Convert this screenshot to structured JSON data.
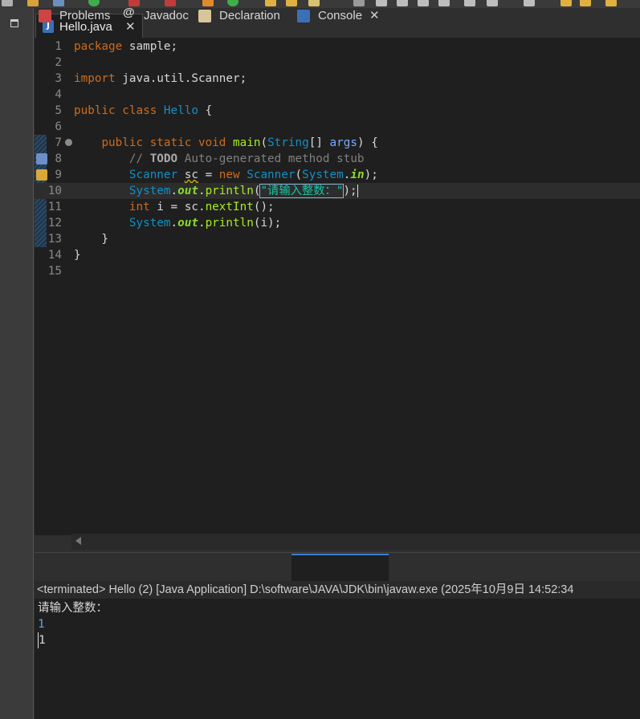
{
  "editor": {
    "tab": {
      "label": "Hello.java",
      "icon": "java-file-icon"
    },
    "lines": [
      {
        "n": "1",
        "tokens": [
          {
            "c": "kw",
            "t": "package"
          },
          {
            "c": "",
            "t": " sample;"
          }
        ]
      },
      {
        "n": "2",
        "tokens": []
      },
      {
        "n": "3",
        "tokens": [
          {
            "c": "kw",
            "t": "import"
          },
          {
            "c": "",
            "t": " java.util.Scanner;"
          }
        ]
      },
      {
        "n": "4",
        "tokens": []
      },
      {
        "n": "5",
        "tokens": [
          {
            "c": "kw",
            "t": "public"
          },
          {
            "c": "",
            "t": " "
          },
          {
            "c": "kw",
            "t": "class"
          },
          {
            "c": "",
            "t": " "
          },
          {
            "c": "cls",
            "t": "Hello"
          },
          {
            "c": "",
            "t": " {"
          }
        ]
      },
      {
        "n": "6",
        "tokens": []
      },
      {
        "n": "7",
        "tokens": [
          {
            "c": "",
            "t": "    "
          },
          {
            "c": "kw",
            "t": "public"
          },
          {
            "c": "",
            "t": " "
          },
          {
            "c": "kw",
            "t": "static"
          },
          {
            "c": "",
            "t": " "
          },
          {
            "c": "kw",
            "t": "void"
          },
          {
            "c": "",
            "t": " "
          },
          {
            "c": "meth",
            "t": "main"
          },
          {
            "c": "",
            "t": "("
          },
          {
            "c": "ty",
            "t": "String"
          },
          {
            "c": "",
            "t": "[] "
          },
          {
            "c": "param",
            "t": "args"
          },
          {
            "c": "",
            "t": ") {"
          }
        ]
      },
      {
        "n": "8",
        "tokens": [
          {
            "c": "",
            "t": "        "
          },
          {
            "c": "cmt",
            "t": "// "
          },
          {
            "c": "todo",
            "t": "TODO"
          },
          {
            "c": "cmt",
            "t": " Auto-generated method stub"
          }
        ]
      },
      {
        "n": "9",
        "tokens": [
          {
            "c": "",
            "t": "        "
          },
          {
            "c": "ty",
            "t": "Scanner"
          },
          {
            "c": "",
            "t": " "
          },
          {
            "c": "warn",
            "t": "sc"
          },
          {
            "c": "",
            "t": " = "
          },
          {
            "c": "kw",
            "t": "new"
          },
          {
            "c": "",
            "t": " "
          },
          {
            "c": "ty",
            "t": "Scanner"
          },
          {
            "c": "",
            "t": "("
          },
          {
            "c": "ty",
            "t": "System"
          },
          {
            "c": "",
            "t": "."
          },
          {
            "c": "fld",
            "t": "in"
          },
          {
            "c": "",
            "t": ");"
          }
        ]
      },
      {
        "n": "10",
        "current": true,
        "tokens": [
          {
            "c": "",
            "t": "        "
          },
          {
            "c": "ty",
            "t": "System"
          },
          {
            "c": "",
            "t": "."
          },
          {
            "c": "fld",
            "t": "out"
          },
          {
            "c": "",
            "t": "."
          },
          {
            "c": "meth",
            "t": "println"
          },
          {
            "c": "",
            "t": "("
          },
          {
            "c": "str strbox",
            "t": "\"请输入整数：\""
          },
          {
            "c": "caret",
            "t": ");"
          }
        ]
      },
      {
        "n": "11",
        "tokens": [
          {
            "c": "",
            "t": "        "
          },
          {
            "c": "kw",
            "t": "int"
          },
          {
            "c": "",
            "t": " i = sc."
          },
          {
            "c": "meth",
            "t": "nextInt"
          },
          {
            "c": "",
            "t": "();"
          }
        ]
      },
      {
        "n": "12",
        "tokens": [
          {
            "c": "",
            "t": "        "
          },
          {
            "c": "ty",
            "t": "System"
          },
          {
            "c": "",
            "t": "."
          },
          {
            "c": "fld",
            "t": "out"
          },
          {
            "c": "",
            "t": "."
          },
          {
            "c": "meth",
            "t": "println"
          },
          {
            "c": "",
            "t": "(i);"
          }
        ]
      },
      {
        "n": "13",
        "tokens": [
          {
            "c": "",
            "t": "    }"
          }
        ]
      },
      {
        "n": "14",
        "tokens": [
          {
            "c": "",
            "t": "}"
          }
        ]
      },
      {
        "n": "15",
        "tokens": []
      }
    ]
  },
  "panel": {
    "tabs": [
      {
        "label": "Problems",
        "icon": "problems-icon"
      },
      {
        "label": "Javadoc",
        "icon": "javadoc-icon"
      },
      {
        "label": "Declaration",
        "icon": "declaration-icon"
      },
      {
        "label": "Console",
        "icon": "console-icon",
        "active": true
      }
    ]
  },
  "console": {
    "header": "<terminated> Hello (2) [Java Application] D:\\software\\JAVA\\JDK\\bin\\javaw.exe  (2025年10月9日 14:52:34",
    "lines": [
      {
        "t": "请输入整数：",
        "kind": "out"
      },
      {
        "t": "1",
        "kind": "inp"
      },
      {
        "t": "1",
        "kind": "plain"
      }
    ]
  },
  "colors": {
    "keyword": "#cc6c1d",
    "type": "#1290c3",
    "method": "#a7ec21",
    "string": "#17c6a3",
    "comment": "#808080",
    "accent": "#3c7fd6"
  }
}
